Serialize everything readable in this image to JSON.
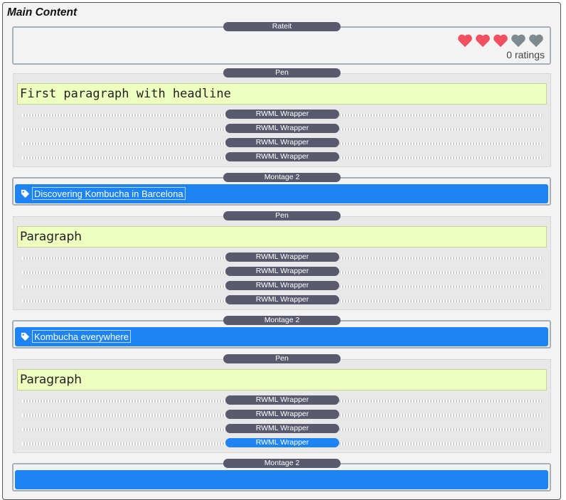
{
  "main_title": "Main Content",
  "rate_module": {
    "label": "Rateit",
    "rating_filled": 3,
    "rating_max": 5,
    "ratings_text": "0 ratings",
    "heart_filled_color": "#f0505f",
    "heart_empty_color": "#7f8a90"
  },
  "pen_modules": [
    {
      "label": "Pen",
      "text": "First paragraph with headline",
      "wrappers": [
        "RWML Wrapper",
        "RWML Wrapper",
        "RWML Wrapper",
        "RWML Wrapper"
      ]
    },
    {
      "label": "Pen",
      "text": "Paragraph",
      "wrappers": [
        "RWML Wrapper",
        "RWML Wrapper",
        "RWML Wrapper",
        "RWML Wrapper"
      ]
    },
    {
      "label": "Pen",
      "text": "Paragraph",
      "wrappers": [
        "RWML Wrapper",
        "RWML Wrapper",
        "RWML Wrapper",
        "RWML Wrapper"
      ]
    }
  ],
  "montage_modules": [
    {
      "label": "Montage 2",
      "tag_text": "Discovering Kombucha in Barcelona",
      "tag_icon": "tag-icon"
    },
    {
      "label": "Montage 2",
      "tag_text": "Kombucha everywhere",
      "tag_icon": "tag-icon"
    },
    {
      "label": "Montage 2"
    }
  ],
  "colors": {
    "accent": "#1e84f5",
    "label_pill": "#5a5a6e",
    "pen_text_bg": "#efffc0"
  }
}
